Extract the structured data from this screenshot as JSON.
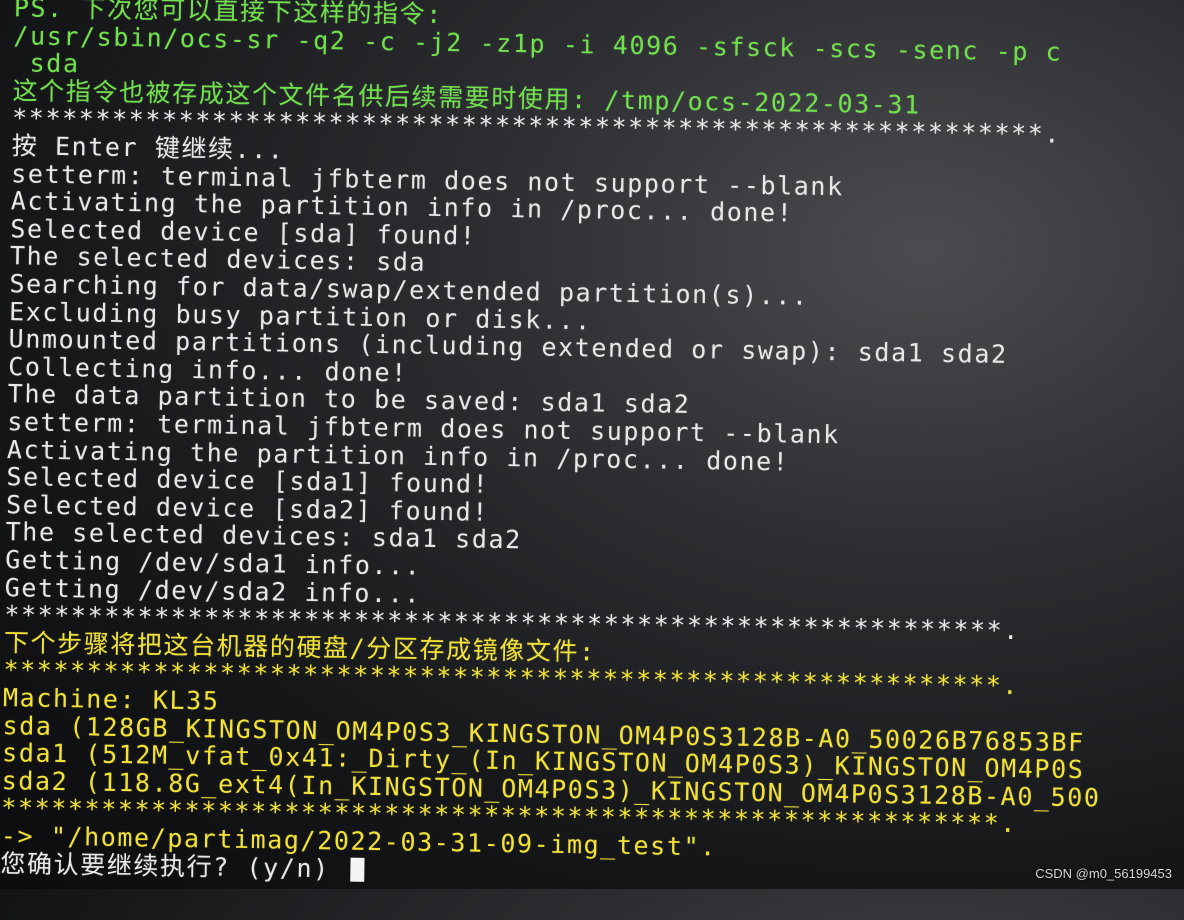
{
  "terminal": {
    "colors": {
      "green": "#6fe24a",
      "white": "#e8e8e8",
      "yellow": "#f2e233",
      "background": "#151618"
    },
    "lines": [
      {
        "text": "PS. 下次您可以直接下这样的指令:",
        "color": "green",
        "tail_white": "****************."
      },
      {
        "text": "/usr/sbin/ocs-sr -q2 -c -j2 -z1p -i 4096 -sfsck -scs -senc -p c",
        "color": "green"
      },
      {
        "text": " sda",
        "color": "green"
      },
      {
        "text": "这个指令也被存成这个文件名供后续需要时使用: /tmp/ocs-2022-03-31",
        "color": "green"
      },
      {
        "text": "**************************************************************.",
        "color": "white"
      },
      {
        "text": "按 Enter 键继续...",
        "color": "white"
      },
      {
        "text": "setterm: terminal jfbterm does not support --blank",
        "color": "white"
      },
      {
        "text": "Activating the partition info in /proc... done!",
        "color": "white"
      },
      {
        "text": "Selected device [sda] found!",
        "color": "white"
      },
      {
        "text": "The selected devices: sda",
        "color": "white"
      },
      {
        "text": "Searching for data/swap/extended partition(s)...",
        "color": "white"
      },
      {
        "text": "Excluding busy partition or disk...",
        "color": "white"
      },
      {
        "text": "Unmounted partitions (including extended or swap): sda1 sda2",
        "color": "white"
      },
      {
        "text": "Collecting info... done!",
        "color": "white"
      },
      {
        "text": "The data partition to be saved: sda1 sda2",
        "color": "white"
      },
      {
        "text": "setterm: terminal jfbterm does not support --blank",
        "color": "white"
      },
      {
        "text": "Activating the partition info in /proc... done!",
        "color": "white"
      },
      {
        "text": "Selected device [sda1] found!",
        "color": "white"
      },
      {
        "text": "Selected device [sda2] found!",
        "color": "white"
      },
      {
        "text": "The selected devices: sda1 sda2",
        "color": "white"
      },
      {
        "text": "Getting /dev/sda1 info...",
        "color": "white"
      },
      {
        "text": "Getting /dev/sda2 info...",
        "color": "white"
      },
      {
        "text": "************************************************************.",
        "color": "white"
      },
      {
        "text": "下个步骤将把这台机器的硬盘/分区存成镜像文件:",
        "color": "yellow"
      },
      {
        "text": "************************************************************.",
        "color": "yellow"
      },
      {
        "text": "Machine: KL35",
        "color": "yellow"
      },
      {
        "text": "sda (128GB_KINGSTON_OM4P0S3_KINGSTON_OM4P0S3128B-A0_50026B76853BF",
        "color": "yellow"
      },
      {
        "text": "sda1 (512M_vfat_0x41:_Dirty_(In_KINGSTON_OM4P0S3)_KINGSTON_OM4P0S",
        "color": "yellow"
      },
      {
        "text": "sda2 (118.8G_ext4(In_KINGSTON_OM4P0S3)_KINGSTON_OM4P0S3128B-A0_500",
        "color": "yellow"
      },
      {
        "text": "************************************************************.",
        "color": "yellow"
      },
      {
        "text": "-> \"/home/partimag/2022-03-31-09-img_test\".",
        "color": "yellow"
      }
    ],
    "prompt": {
      "text": "您确认要继续执行? (y/n) ",
      "color": "white"
    }
  },
  "watermark": "CSDN @m0_56199453"
}
